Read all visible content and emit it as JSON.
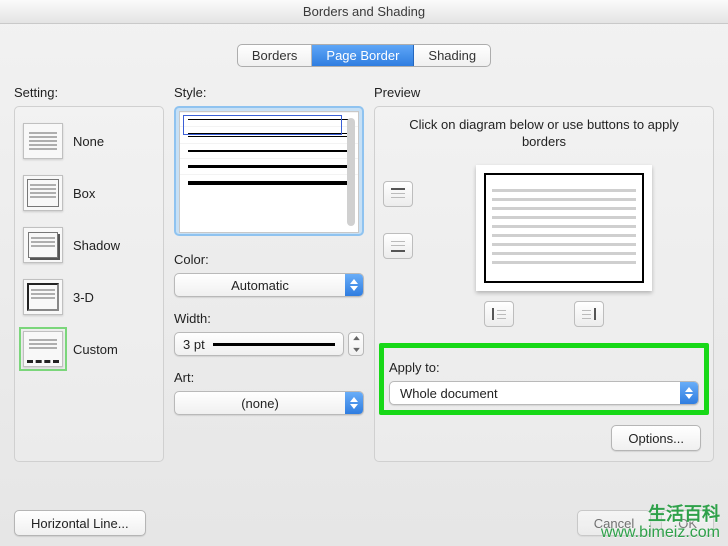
{
  "window_title": "Borders and Shading",
  "tabs": {
    "borders": "Borders",
    "page_border": "Page Border",
    "shading": "Shading",
    "active": "Page Border"
  },
  "setting": {
    "label": "Setting:",
    "items": [
      {
        "label": "None"
      },
      {
        "label": "Box"
      },
      {
        "label": "Shadow"
      },
      {
        "label": "3-D"
      },
      {
        "label": "Custom"
      }
    ],
    "selected": "Custom"
  },
  "style": {
    "label": "Style:"
  },
  "color": {
    "label": "Color:",
    "value": "Automatic"
  },
  "width": {
    "label": "Width:",
    "value": "3 pt"
  },
  "art": {
    "label": "Art:",
    "value": "(none)"
  },
  "preview": {
    "label": "Preview",
    "hint": "Click on diagram below or use buttons to apply borders"
  },
  "apply_to": {
    "label": "Apply to:",
    "value": "Whole document"
  },
  "buttons": {
    "options": "Options...",
    "horizontal_line": "Horizontal Line...",
    "cancel": "Cancel",
    "ok": "OK"
  },
  "watermark": {
    "cn": "生活百科",
    "url": "www.bimeiz.com"
  }
}
